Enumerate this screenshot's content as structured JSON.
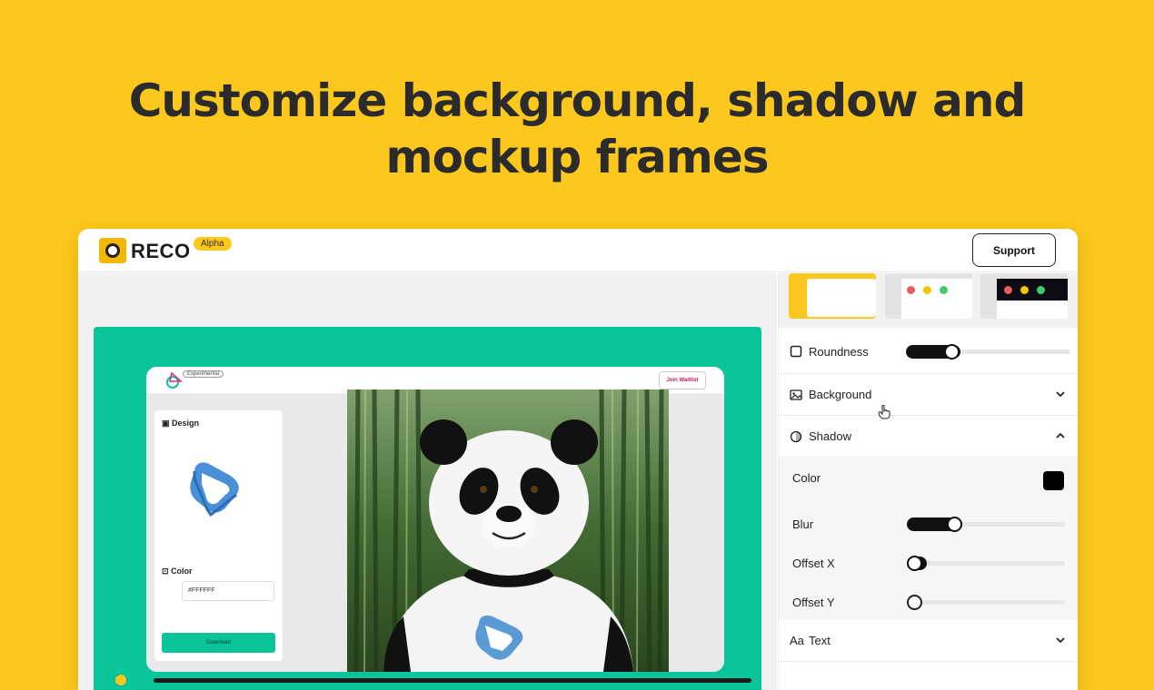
{
  "headline": {
    "line1": "Customize background, shadow and",
    "line2": "mockup frames"
  },
  "app": {
    "brand": "RECO",
    "badge": "Alpha",
    "support_label": "Support"
  },
  "inner_app": {
    "badge": "Experimental",
    "join_label": "Join Waitlist",
    "design_label": "Design",
    "color_label": "Color",
    "hex_value": "#FFFFFF",
    "download_label": "Download"
  },
  "panel": {
    "roundness_label": "Roundness",
    "background_label": "Background",
    "shadow_label": "Shadow",
    "text_label": "Text",
    "text_prefix": "Aa",
    "shadow": {
      "color_label": "Color",
      "blur_label": "Blur",
      "offset_x_label": "Offset X",
      "offset_y_label": "Offset Y",
      "color_value": "#000000"
    }
  },
  "slider_values": {
    "roundness": 0.28,
    "blur": 0.3,
    "offset_x": 0.0,
    "offset_y": 0.0,
    "playhead": 0.0
  },
  "colors": {
    "page_bg": "#FCC81D",
    "stage_green": "#0AC49A",
    "frame_dot_red": "#E85D5D",
    "frame_dot_yellow": "#F5C400",
    "frame_dot_green": "#3DCB6C"
  },
  "icons": [
    "square-icon",
    "image-icon",
    "circle-half-icon",
    "chevron-down-icon",
    "chevron-up-icon",
    "play-icon",
    "pointer-cursor-icon"
  ]
}
